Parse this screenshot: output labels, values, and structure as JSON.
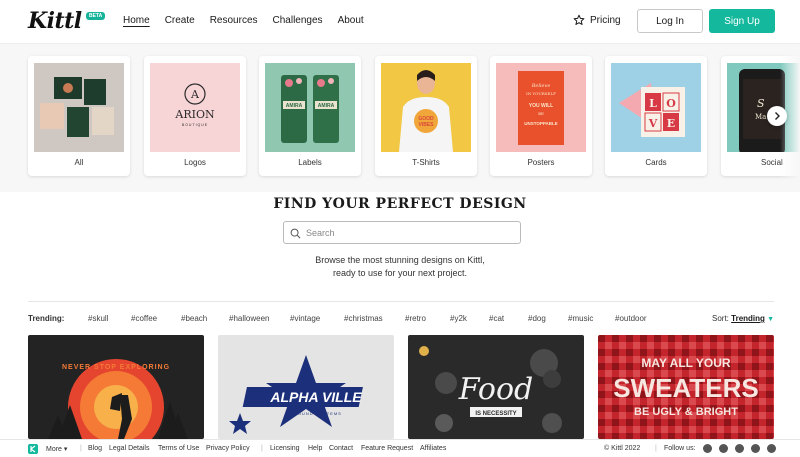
{
  "header": {
    "logo": "Kittl",
    "beta": "BETA",
    "nav": [
      "Home",
      "Create",
      "Resources",
      "Challenges",
      "About"
    ],
    "pricing": "Pricing",
    "login": "Log In",
    "signup": "Sign Up"
  },
  "categories": [
    {
      "label": "All"
    },
    {
      "label": "Logos",
      "brand": "ARION",
      "sub": "BOUTIQUE"
    },
    {
      "label": "Labels",
      "brand": "AMIRA"
    },
    {
      "label": "T-Shirts",
      "shirt_text": "GOOD VIBES"
    },
    {
      "label": "Posters",
      "poster_text": "BELIEVE IN YOURSELF AND YOU WILL BE UNSTOPPABLE"
    },
    {
      "label": "Cards",
      "card_text": "LOVE"
    },
    {
      "label": "Social"
    }
  ],
  "hero": {
    "title": "FIND YOUR PERFECT DESIGN",
    "search_placeholder": "Search",
    "subtitle_line1": "Browse the most stunning designs on Kittl,",
    "subtitle_line2": "ready to use for your next project."
  },
  "trending": {
    "label": "Trending:",
    "tags": [
      "#skull",
      "#coffee",
      "#beach",
      "#halloween",
      "#vintage",
      "#christmas",
      "#retro",
      "#y2k",
      "#cat",
      "#dog",
      "#music",
      "#outdoor"
    ],
    "sort_label": "Sort:",
    "sort_value": "Trending"
  },
  "designs": [
    {
      "name": "never-stop-exploring",
      "text": "NEVER STOP EXPLORING"
    },
    {
      "name": "alpha-ville",
      "text": "ALPHA VILLE",
      "sub": "SOUND SYSTEMS"
    },
    {
      "name": "food-is-necessity",
      "text": "Food",
      "sub": "IS NECESSITY"
    },
    {
      "name": "sweaters",
      "line1": "MAY ALL YOUR",
      "line2": "SWEATERS",
      "line3": "BE UGLY & BRIGHT"
    }
  ],
  "footer": {
    "more": "More",
    "links": [
      "Blog",
      "Legal Details",
      "Terms of Use",
      "Privacy Policy",
      "Licensing",
      "Help",
      "Contact",
      "Feature Request",
      "Affiliates"
    ],
    "copyright": "© Kittl 2022",
    "follow": "Follow us:"
  },
  "colors": {
    "accent": "#13b89d",
    "border": "#e6e6e6"
  }
}
